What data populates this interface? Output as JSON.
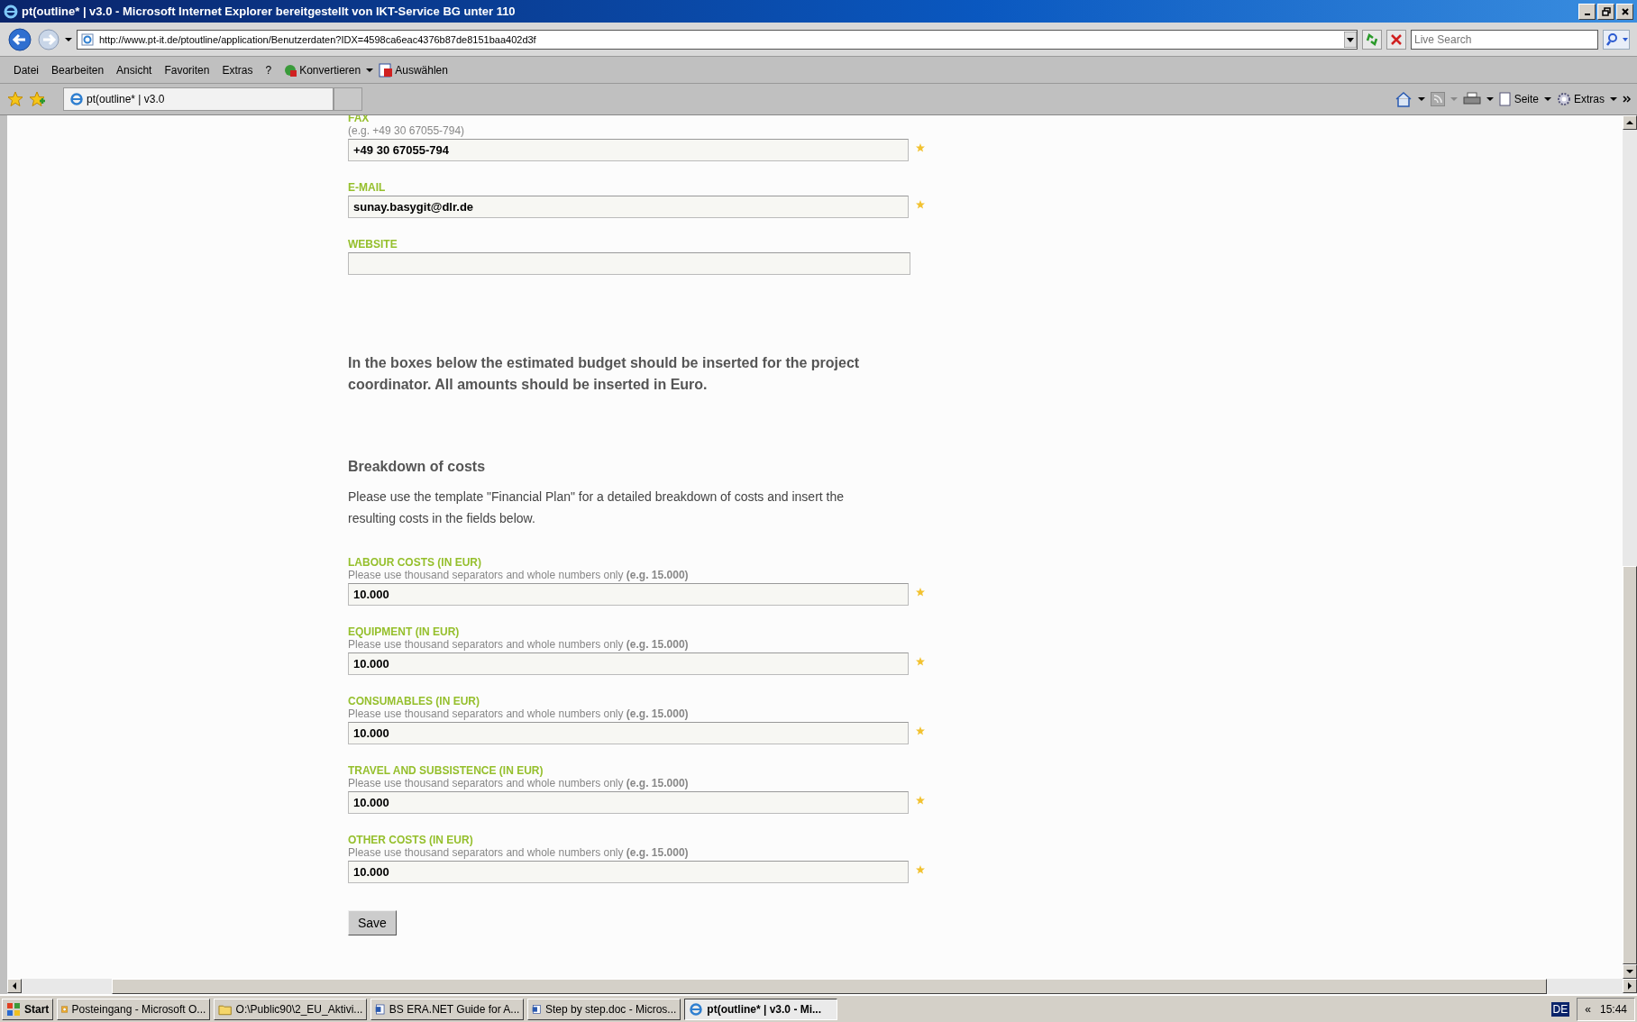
{
  "window": {
    "title": "pt(outline* | v3.0 - Microsoft Internet Explorer bereitgestellt von IKT-Service BG unter 110"
  },
  "address_bar": {
    "url": "http://www.pt-it.de/ptoutline/application/Benutzerdaten?IDX=4598ca6eac4376b87de8151baa402d3f",
    "search_placeholder": "Live Search"
  },
  "menu": [
    "Datei",
    "Bearbeiten",
    "Ansicht",
    "Favoriten",
    "Extras",
    "?"
  ],
  "toolbar": {
    "convert": "Konvertieren",
    "select": "Auswählen"
  },
  "tabs": [
    {
      "label": "pt(outline* | v3.0",
      "selected": true
    }
  ],
  "command_bar": {
    "page": "Seite",
    "extras": "Extras"
  },
  "contact_fields": [
    {
      "label": "FAX",
      "hint": "(e.g. +49 30 67055-794)",
      "value": "+49 30 67055-794",
      "required": true
    },
    {
      "label": "E-MAIL",
      "value": "sunay.basygit@dlr.de",
      "required": true
    },
    {
      "label": "WEBSITE",
      "required": false
    }
  ],
  "intro": "In the boxes below the estimated budget should be inserted for the project coordinator. All amounts should be inserted in Euro.",
  "section": {
    "title": "Breakdown of costs",
    "text": "Please use the template \"Financial Plan\" for a detailed breakdown of costs and insert the resulting costs in the fields below."
  },
  "cost_fields": [
    {
      "label": "LABOUR COSTS (IN EUR)",
      "hint": "Please use thousand separators and whole numbers only **(e.g. 15.000)**",
      "value": "10.000",
      "required": true
    },
    {
      "label": "EQUIPMENT (IN EUR)",
      "hint": "Please use thousand separators and whole numbers only **(e.g. 15.000)**",
      "value": "10.000",
      "required": true
    },
    {
      "label": "CONSUMABLES (IN EUR)",
      "hint": "Please use thousand separators and whole numbers only **(e.g. 15.000)**",
      "value": "10.000",
      "required": true
    },
    {
      "label": "TRAVEL AND SUBSISTENCE (IN EUR)",
      "hint": "Please use thousand separators and whole numbers only **(e.g. 15.000)**",
      "value": "10.000",
      "required": true
    },
    {
      "label": "OTHER COSTS (IN EUR)",
      "hint": "Please use thousand separators and whole numbers only **(e.g. 15.000)**",
      "value": "10.000",
      "required": true
    }
  ],
  "save_button": "Save",
  "taskbar": {
    "start": "Start",
    "items": [
      {
        "label": "Posteingang - Microsoft O...",
        "kind": "mail",
        "selected": false
      },
      {
        "label": "O:\\Public90\\2_EU_Aktivi...",
        "kind": "folder",
        "selected": false
      },
      {
        "label": "BS ERA.NET Guide for A...",
        "kind": "word",
        "selected": false
      },
      {
        "label": "Step by step.doc - Micros...",
        "kind": "word",
        "selected": false
      },
      {
        "label": "pt(outline* | v3.0 - Mi...",
        "kind": "ie",
        "selected": true
      }
    ],
    "language": "DE",
    "chevron": "«",
    "clock": "15:44"
  }
}
